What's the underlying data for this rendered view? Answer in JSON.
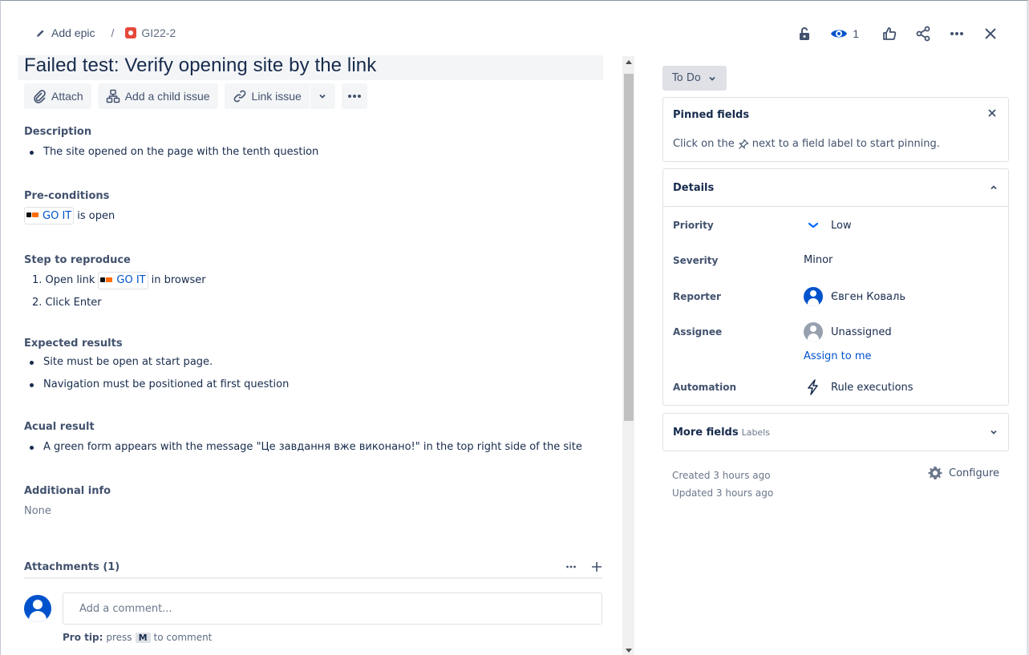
{
  "header": {
    "add_epic": "Add epic",
    "separator": "/",
    "issue_key": "GI22-2",
    "watch_count": "1"
  },
  "issue": {
    "title": "Failed test: Verify opening site by the link"
  },
  "toolbar": {
    "attach": "Attach",
    "add_child": "Add a child issue",
    "link_issue": "Link issue"
  },
  "description": {
    "heading": "Description",
    "items": [
      "The site opened on the page with the tenth question"
    ]
  },
  "preconditions": {
    "heading": "Pre-conditions",
    "chip": "GO IT",
    "suffix": "is open"
  },
  "steps": {
    "heading": "Step to reproduce",
    "step1_prefix": "1. Open link",
    "step1_chip": "GO IT",
    "step1_suffix": "in browser",
    "step2": "2. Click Enter"
  },
  "expected": {
    "heading": "Expected results",
    "items": [
      "Site must be open at start page.",
      "Navigation must be positioned at first question"
    ]
  },
  "actual": {
    "heading": "Acual result",
    "items": [
      "A green form appears with the message \"Це завдання вже виконано!\" in the top right side of the site"
    ]
  },
  "additional": {
    "heading": "Additional info",
    "value": "None"
  },
  "attachments": {
    "label": "Attachments (1)"
  },
  "comment": {
    "placeholder": "Add a comment...",
    "protip_label": "Pro tip:",
    "protip_text1": "press",
    "protip_key": "M",
    "protip_text2": "to comment"
  },
  "sidebar": {
    "status": "To Do",
    "pinned": {
      "title": "Pinned fields",
      "text_before": "Click on the",
      "text_after": "next to a field label to start pinning."
    },
    "details": {
      "title": "Details",
      "priority_label": "Priority",
      "priority_value": "Low",
      "severity_label": "Severity",
      "severity_value": "Minor",
      "reporter_label": "Reporter",
      "reporter_value": "Євген Коваль",
      "assignee_label": "Assignee",
      "assignee_value": "Unassigned",
      "assign_link": "Assign to me",
      "automation_label": "Automation",
      "automation_value": "Rule executions"
    },
    "more_fields": {
      "title": "More fields",
      "sub": "Labels"
    },
    "created": "Created 3 hours ago",
    "updated": "Updated 3 hours ago",
    "configure": "Configure"
  },
  "colors": {
    "link": "#0052cc",
    "text": "#172b4d",
    "issue_type": "#e5493a",
    "priority_low": "#0065ff"
  }
}
